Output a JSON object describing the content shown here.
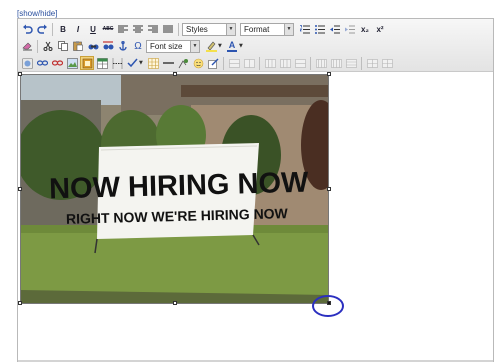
{
  "editor": {
    "show_hide_label": "[show/hide]",
    "toolbar": {
      "row1": {
        "bold": "B",
        "italic": "I",
        "underline": "U",
        "strike": "ABC",
        "subscript": "x₂",
        "superscript": "x²",
        "styles_dropdown": "Styles",
        "format_dropdown": "Format"
      },
      "row2": {
        "omega": "Ω",
        "fontsize_dropdown": "Font size",
        "text_color_letter": "A"
      }
    },
    "content": {
      "image": {
        "banner_line1": "NOW HIRING NOW",
        "banner_line2": "RIGHT NOW WE'RE HIRING NOW"
      }
    },
    "colors": {
      "banner_text": "#111111",
      "highlight_circle": "#2b2fc0",
      "accent": "#2a4f9e"
    }
  }
}
